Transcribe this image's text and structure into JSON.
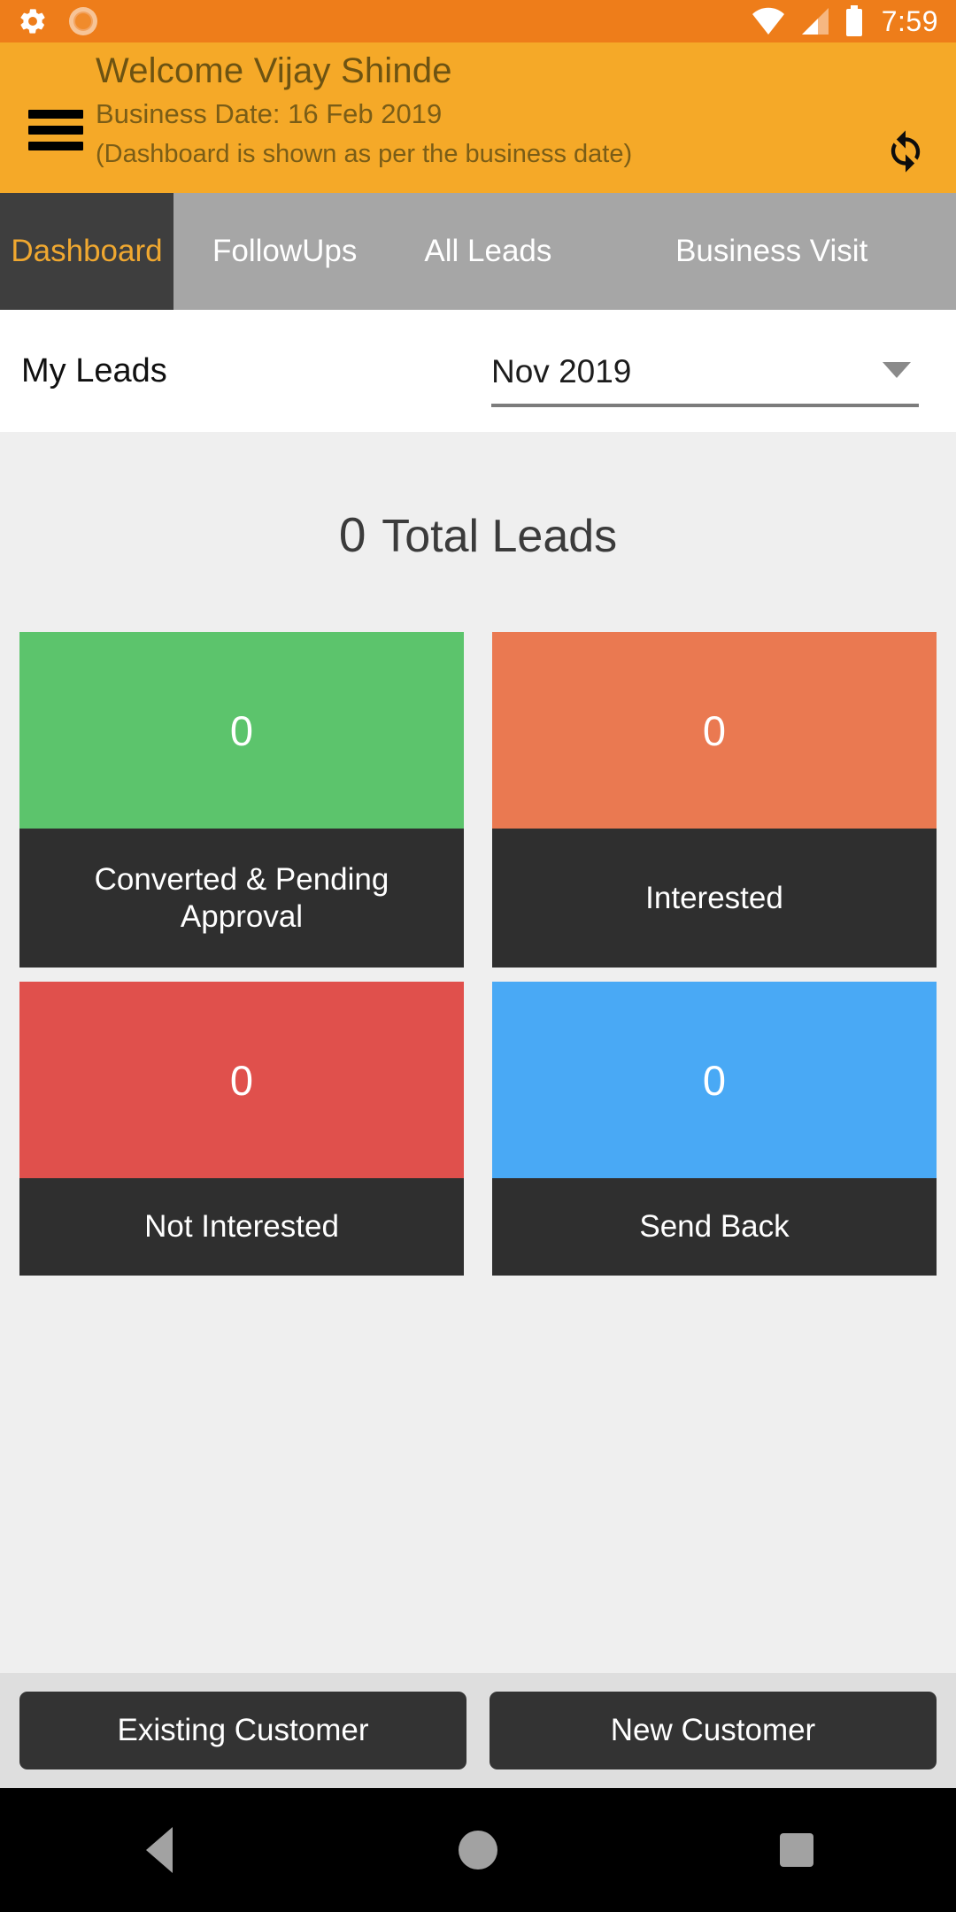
{
  "status_bar": {
    "time": "7:59",
    "icons": [
      "gear-icon",
      "sun-icon",
      "wifi-icon",
      "cell-signal-icon",
      "battery-icon"
    ]
  },
  "header": {
    "menu_icon": "hamburger-menu-icon",
    "welcome": "Welcome Vijay Shinde",
    "business_date": "Business Date: 16 Feb 2019",
    "hint": "(Dashboard is shown as per the business date)",
    "refresh_icon": "refresh-icon",
    "bg_color": "#f5a928",
    "text_color": "#7a5d17"
  },
  "tabs": {
    "active": "Dashboard",
    "items": [
      {
        "label": "Dashboard"
      },
      {
        "label": "FollowUps"
      },
      {
        "label": "All Leads"
      },
      {
        "label": "Business Visit"
      }
    ],
    "active_bg": "#3e3e3e",
    "active_text": "#f0a830",
    "inactive_bg": "#a6a6a6"
  },
  "filter": {
    "title": "My Leads",
    "period_value": "Nov 2019",
    "caret_icon": "chevron-down-icon"
  },
  "summary": {
    "total_count": "0",
    "total_label": "Total Leads"
  },
  "cards": [
    {
      "value": "0",
      "label": "Converted & Pending Approval",
      "color": "#5cc46c"
    },
    {
      "value": "0",
      "label": "Interested",
      "color": "#ea7951"
    },
    {
      "value": "0",
      "label": "Not Interested",
      "color": "#e0504c"
    },
    {
      "value": "0",
      "label": "Send Back",
      "color": "#49a9f5"
    }
  ],
  "actions": {
    "existing_customer": "Existing Customer",
    "new_customer": "New Customer"
  },
  "navbar": {
    "back": "back-icon",
    "home": "home-icon",
    "recents": "recents-icon"
  }
}
